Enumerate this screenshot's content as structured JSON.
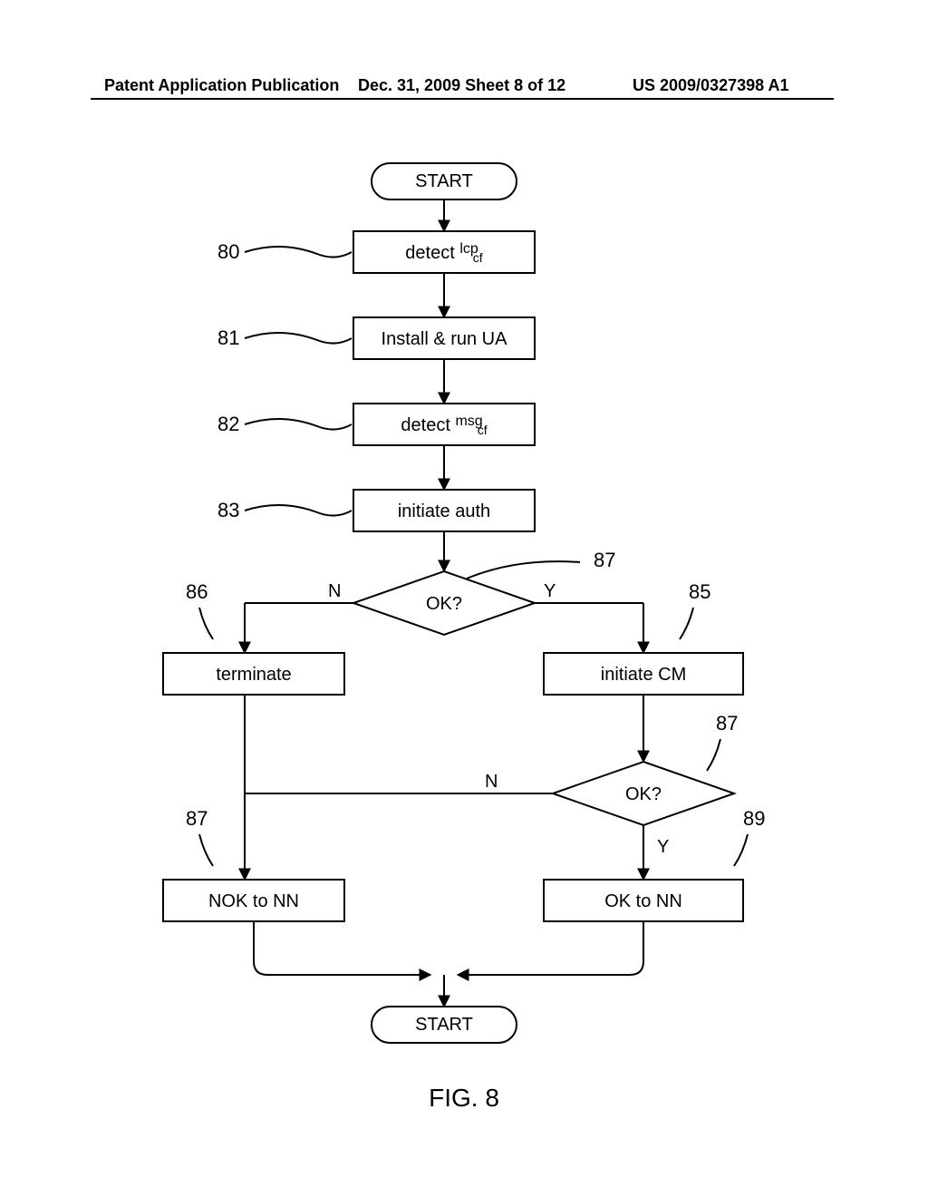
{
  "header": {
    "left": "Patent Application Publication",
    "center": "Dec. 31, 2009  Sheet 8 of 12",
    "right": "US 2009/0327398 A1"
  },
  "figure_caption": "FIG. 8",
  "flowchart": {
    "start": "START",
    "end": "START",
    "step80": {
      "ref": "80",
      "label_prefix": "detect ",
      "sup": "lcp",
      "sub": "cf"
    },
    "step81": {
      "ref": "81",
      "label": "Install & run UA"
    },
    "step82": {
      "ref": "82",
      "label_prefix": "detect ",
      "sup": "msg",
      "sub": "cf"
    },
    "step83": {
      "ref": "83",
      "label": "initiate auth"
    },
    "decision84": {
      "ref_line": "87",
      "label": "OK?",
      "yes": "Y",
      "no": "N"
    },
    "step85": {
      "ref": "85",
      "label": "initiate CM"
    },
    "step86": {
      "ref": "86",
      "label": "terminate"
    },
    "decision87b": {
      "ref_loop": "87",
      "ref_right": "89",
      "label": "OK?",
      "yes": "Y",
      "no": "N"
    },
    "step87": {
      "ref": "87",
      "label": "NOK to NN"
    },
    "step89": {
      "label": "OK to NN"
    }
  }
}
